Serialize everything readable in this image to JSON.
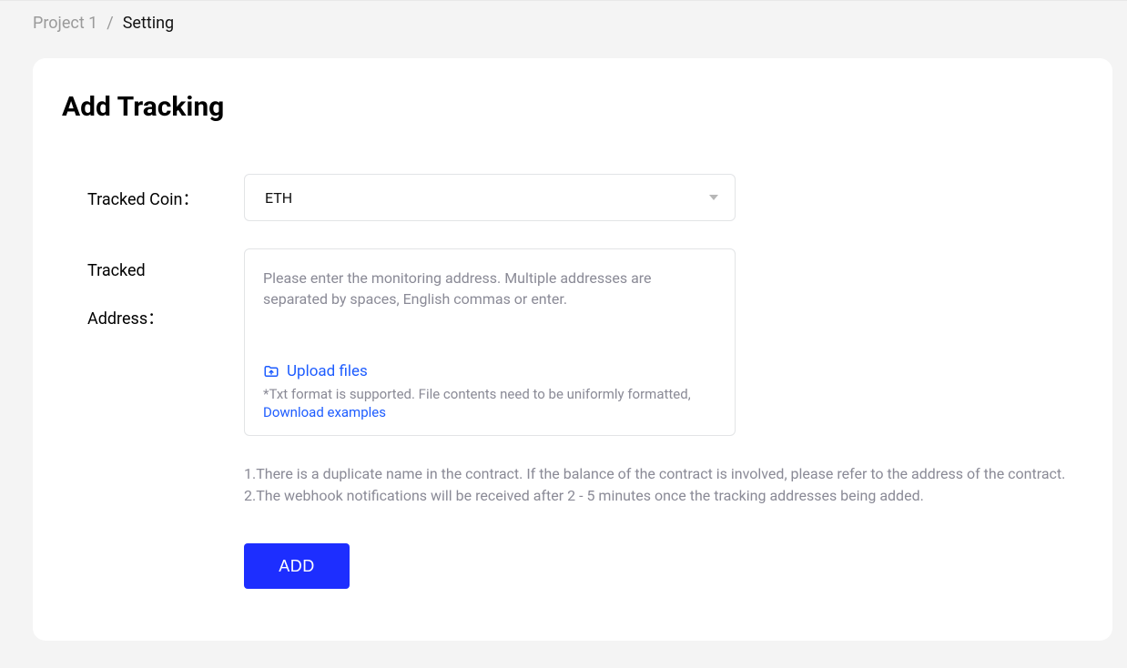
{
  "breadcrumb": {
    "item0": "Project 1",
    "sep": "/",
    "current": "Setting"
  },
  "page": {
    "title": "Add Tracking"
  },
  "form": {
    "tracked_coin": {
      "label": "Tracked Coin：",
      "value": "ETH"
    },
    "tracked_address": {
      "label_line1": "Tracked",
      "label_line2": "Address：",
      "placeholder": "Please enter the monitoring address. Multiple addresses are separated by spaces, English commas or enter.",
      "upload_label": "Upload files",
      "upload_hint": "*Txt format is supported. File contents need to be uniformly formatted,",
      "download_label": "Download examples"
    }
  },
  "notes": {
    "line1": "1.There is a duplicate name in the contract. If the balance of the contract is involved, please refer to the address of the contract.",
    "line2": "2.The webhook notifications will be received after 2 - 5 minutes once the tracking addresses being added."
  },
  "actions": {
    "add_label": "ADD"
  }
}
